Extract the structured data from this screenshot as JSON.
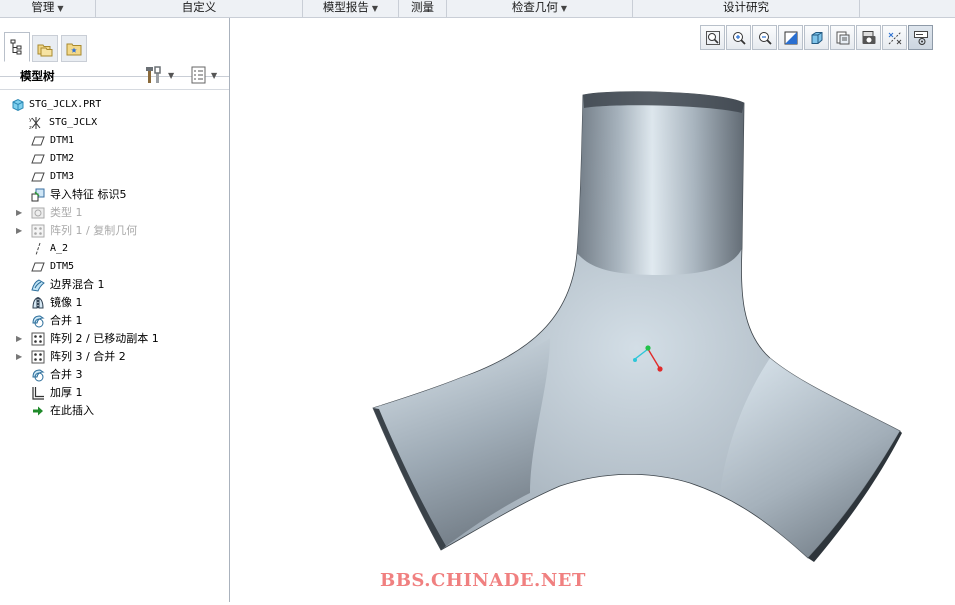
{
  "menubar": {
    "groups": [
      {
        "label": "管理",
        "chev": "▼"
      },
      {
        "label": "自定义",
        "chev": ""
      },
      {
        "label": "模型报告",
        "chev": "▼"
      },
      {
        "label": "测量",
        "chev": ""
      },
      {
        "label": "检查几何",
        "chev": "▼"
      },
      {
        "label": "设计研究",
        "chev": ""
      }
    ]
  },
  "navigator": {
    "tabs": [
      {
        "icon": "model-tree-icon",
        "active": true
      },
      {
        "icon": "folder-browser-icon",
        "active": false
      },
      {
        "icon": "favorites-icon",
        "active": false
      }
    ],
    "title": "模型树",
    "settings_icon": "tools-icon",
    "show_icon": "columns-icon",
    "chev": "▼"
  },
  "tree": {
    "items": [
      {
        "label": "STG_JCLX.PRT",
        "icon": "part-icon",
        "level": 0,
        "expander": false,
        "muted": false,
        "mono": true
      },
      {
        "label": "STG_JCLX",
        "icon": "coordinate-system-icon",
        "level": 1,
        "expander": false,
        "muted": false,
        "mono": true
      },
      {
        "label": "DTM1",
        "icon": "datum-plane-icon",
        "level": 1,
        "expander": false,
        "muted": false,
        "mono": true
      },
      {
        "label": "DTM2",
        "icon": "datum-plane-icon",
        "level": 1,
        "expander": false,
        "muted": false,
        "mono": true
      },
      {
        "label": "DTM3",
        "icon": "datum-plane-icon",
        "level": 1,
        "expander": false,
        "muted": false,
        "mono": true
      },
      {
        "label": "导入特征 标识5",
        "icon": "import-feature-icon",
        "level": 1,
        "expander": false,
        "muted": false,
        "mono": false
      },
      {
        "label": "类型 1",
        "icon": "type-feature-icon",
        "level": 1,
        "expander": true,
        "muted": true,
        "mono": false
      },
      {
        "label": "阵列 1 / 复制几何",
        "icon": "pattern-icon",
        "level": 1,
        "expander": true,
        "muted": true,
        "mono": false
      },
      {
        "label": "A_2",
        "icon": "datum-axis-icon",
        "level": 1,
        "expander": false,
        "muted": false,
        "mono": true
      },
      {
        "label": "DTM5",
        "icon": "datum-plane-icon",
        "level": 1,
        "expander": false,
        "muted": false,
        "mono": true
      },
      {
        "label": "边界混合 1",
        "icon": "boundary-blend-icon",
        "level": 1,
        "expander": false,
        "muted": false,
        "mono": false
      },
      {
        "label": "镜像 1",
        "icon": "mirror-icon",
        "level": 1,
        "expander": false,
        "muted": false,
        "mono": false
      },
      {
        "label": "合并 1",
        "icon": "merge-icon",
        "level": 1,
        "expander": false,
        "muted": false,
        "mono": false
      },
      {
        "label": "阵列 2 / 已移动副本 1",
        "icon": "pattern-icon",
        "level": 1,
        "expander": true,
        "muted": false,
        "mono": false
      },
      {
        "label": "阵列 3 / 合并 2",
        "icon": "pattern-icon",
        "level": 1,
        "expander": true,
        "muted": false,
        "mono": false
      },
      {
        "label": "合并 3",
        "icon": "merge-icon",
        "level": 1,
        "expander": false,
        "muted": false,
        "mono": false
      },
      {
        "label": "加厚 1",
        "icon": "thicken-icon",
        "level": 1,
        "expander": false,
        "muted": false,
        "mono": false
      },
      {
        "label": "在此插入",
        "icon": "insert-here-arrow-icon",
        "level": 1,
        "expander": false,
        "muted": false,
        "mono": false
      }
    ]
  },
  "viewbar": {
    "buttons": [
      {
        "icon": "refit-icon",
        "pressed": false
      },
      {
        "icon": "zoom-in-icon",
        "pressed": false
      },
      {
        "icon": "zoom-out-icon",
        "pressed": false
      },
      {
        "icon": "repaint-icon",
        "pressed": false
      },
      {
        "icon": "display-style-icon",
        "pressed": false
      },
      {
        "icon": "saved-orientations-icon",
        "pressed": false
      },
      {
        "icon": "view-manager-icon",
        "pressed": false
      },
      {
        "icon": "datum-display-icon",
        "pressed": false
      },
      {
        "icon": "annotation-display-icon",
        "pressed": true
      }
    ]
  },
  "colors": {
    "surface_dark": "#5d6670",
    "surface_light": "#e6eef4",
    "axis_x": "#e02a2a",
    "axis_y": "#22c24a",
    "axis_z": "#2ec6d8",
    "watermark": "#f08080"
  },
  "watermark": "BBS.CHINADE.NET"
}
